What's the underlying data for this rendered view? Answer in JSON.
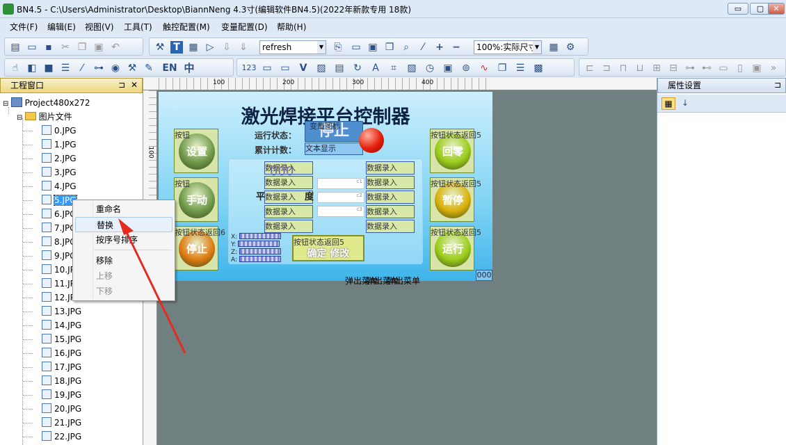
{
  "window": {
    "title": "BN4.5 - C:\\Users\\Administrator\\Desktop\\BiannNeng 4.3寸(编辑软件BN4.5)(2022年新款专用 18款)",
    "min": "▭",
    "max": "▢",
    "close": "✕"
  },
  "menu": [
    "文件(F)",
    "编辑(E)",
    "视图(V)",
    "工具(T)",
    "触控配置(M)",
    "变量配置(D)",
    "帮助(H)"
  ],
  "toolbar1": {
    "combo_refresh": "refresh",
    "combo_zoom": "100%:实际尺寸"
  },
  "toolbar2": {
    "en": "EN",
    "zh": "中",
    "num": "123"
  },
  "ruler": [
    "100",
    "200",
    "300",
    "400"
  ],
  "ruler_v": "100",
  "left_panel": {
    "title": "工程窗口",
    "pin": "⊐",
    "close": "✕",
    "project": "Project480x272",
    "folder": "图片文件",
    "files": [
      "0.JPG",
      "1.JPG",
      "2.JPG",
      "3.JPG",
      "4.JPG",
      "5.JPG",
      "6.JPG",
      "7.JPG",
      "8.JPG",
      "9.JPG",
      "10.JPG",
      "11.JPG",
      "12.JPG",
      "13.JPG",
      "14.JPG",
      "15.JPG",
      "16.JPG",
      "17.JPG",
      "18.JPG",
      "19.JPG",
      "20.JPG",
      "21.JPG",
      "22.JPG"
    ]
  },
  "context_menu": {
    "items": [
      "重命名",
      "替换",
      "按序号排序",
      "移除",
      "上移",
      "下移"
    ],
    "highlighted": "替换"
  },
  "right_panel": {
    "title": "属性设置",
    "pin": "⊐"
  },
  "screen": {
    "title": "激光焊接平台控制器",
    "run_status_label": "运行状态：",
    "count_label": "累计计数：",
    "status_value": "停止",
    "status_overlay": "变量图标",
    "count_value": "文本显示",
    "buttons_left": [
      {
        "caption": "按钮",
        "label": "设置",
        "color": "#6f9a4a"
      },
      {
        "caption": "按钮",
        "label": "手动",
        "color": "#6f9a4a"
      },
      {
        "caption": "按钮状态返回6",
        "label": "停止",
        "color": "#e07b12"
      }
    ],
    "buttons_right": [
      {
        "caption": "按钮状态返回5",
        "label": "回零",
        "color": "#9ccc1a"
      },
      {
        "caption": "按钮状态返回5",
        "label": "暂停",
        "color": "#d9b10c"
      },
      {
        "caption": "按钮状态返回5",
        "label": "运行",
        "color": "#9ccc1a"
      }
    ],
    "data_entry": "数据录入",
    "data_number": "000",
    "side_label": "平",
    "side_label2": "度",
    "confirm": "确定 修改",
    "confirm_caption": "按钮状态返回5",
    "axes": [
      "X:",
      "Y:",
      "Z:",
      "A:"
    ],
    "popup_menu": "弹出菜单",
    "corner_value": "000",
    "input_tags": [
      "c1",
      "c2",
      "c3"
    ]
  }
}
